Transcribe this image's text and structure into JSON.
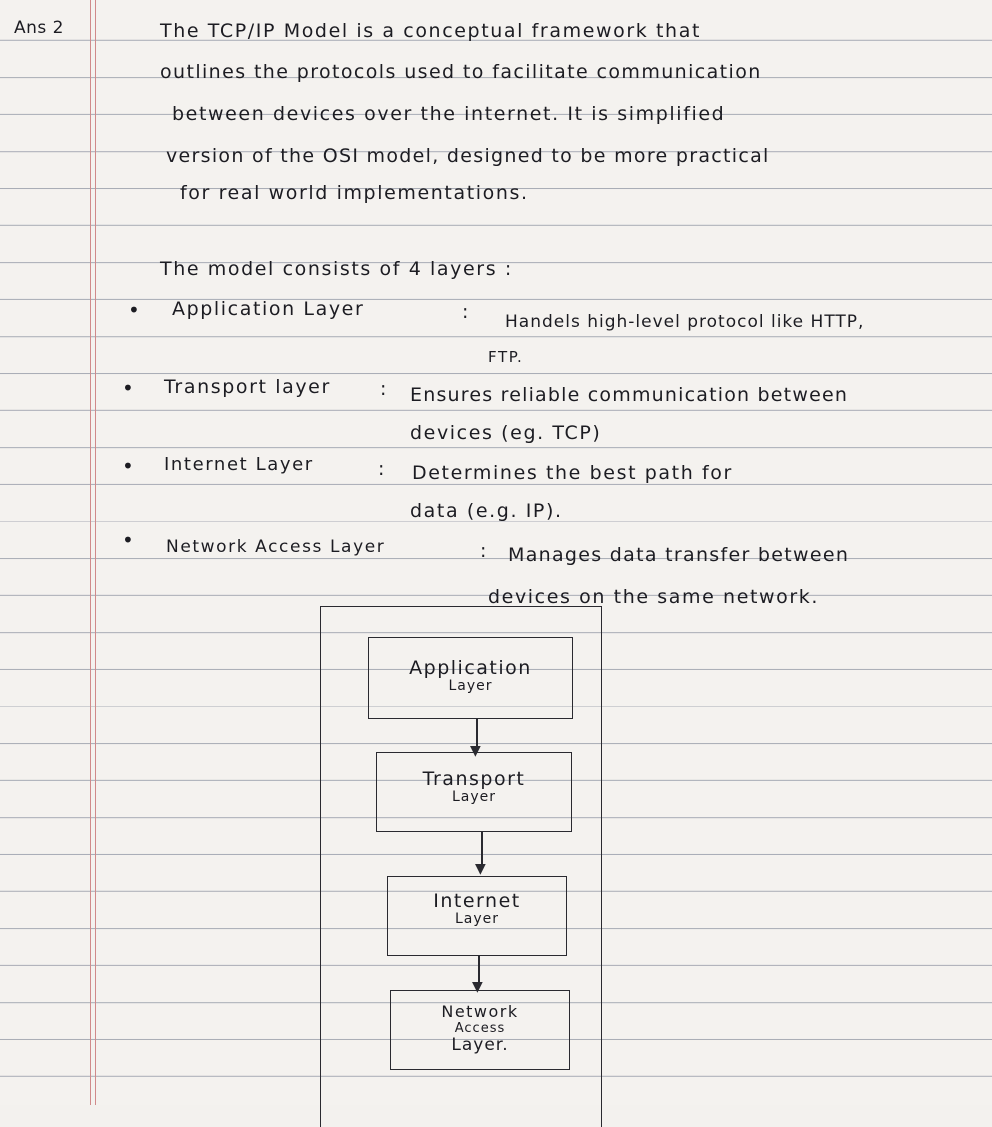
{
  "answer_label": "Ans 2",
  "intro": {
    "lines": [
      "The TCP/IP Model is a conceptual framework that",
      "outlines the protocols used to facilitate communication",
      "between devices over the internet. It is simplified",
      "version of the OSI model, designed to be more practical",
      "for real world implementations."
    ]
  },
  "layers_intro": "The model consists of 4 layers :",
  "layers": [
    {
      "name": "Application Layer",
      "separator": ":",
      "line1": "Handels high-level protocol like HTTP,",
      "line2": "FTP."
    },
    {
      "name": "Transport layer",
      "separator": ":",
      "line1": "Ensures reliable communication between",
      "line2": "devices (eg. TCP)"
    },
    {
      "name": "Internet Layer",
      "separator": ":",
      "line1": "Determines the best path for",
      "line2": "data (e.g. IP)."
    },
    {
      "name": "Network Access Layer",
      "separator": ":",
      "line1": "Manages data transfer between",
      "line2": "devices on the same network."
    }
  ],
  "diagram": {
    "boxes": [
      {
        "line1": "Application",
        "line2": "Layer"
      },
      {
        "line1": "Transport",
        "line2": "Layer"
      },
      {
        "line1": "Internet",
        "line2": "Layer"
      },
      {
        "line1": "Network",
        "line2": "Access",
        "line3": "Layer."
      }
    ]
  }
}
